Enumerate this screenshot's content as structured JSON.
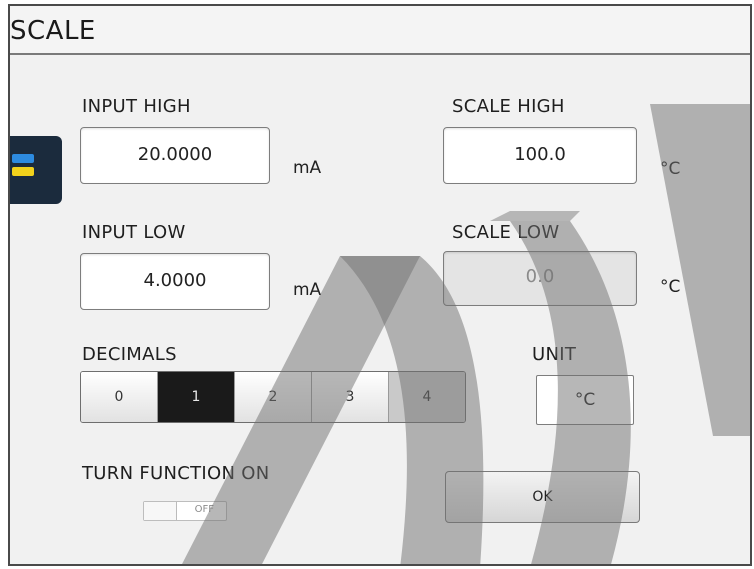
{
  "title": "SCALE",
  "input_high": {
    "label": "INPUT HIGH",
    "value": "20.0000",
    "unit": "mA"
  },
  "input_low": {
    "label": "INPUT LOW",
    "value": "4.0000",
    "unit": "mA"
  },
  "scale_high": {
    "label": "SCALE HIGH",
    "value": "100.0",
    "unit": "°C"
  },
  "scale_low": {
    "label": "SCALE LOW",
    "value": "0.0",
    "unit": "°C"
  },
  "decimals": {
    "label": "DECIMALS",
    "options": [
      "0",
      "1",
      "2",
      "3",
      "4"
    ],
    "selected": "1"
  },
  "unit_selector": {
    "label": "UNIT",
    "value": "°C"
  },
  "turn_function": {
    "label": "TURN FUNCTION ON",
    "state": "OFF"
  },
  "ok_button": {
    "label": "OK"
  },
  "colors": {
    "selected_segment": "#1a1a1a",
    "side_tab": "#1b2b3d",
    "side_tab_accent_blue": "#2d8be0",
    "side_tab_accent_yellow": "#f2d21c",
    "watermark": "#6f6f6f"
  },
  "icons": {
    "side_tab": "menu-tab-icon",
    "toggle": "toggle-switch"
  }
}
